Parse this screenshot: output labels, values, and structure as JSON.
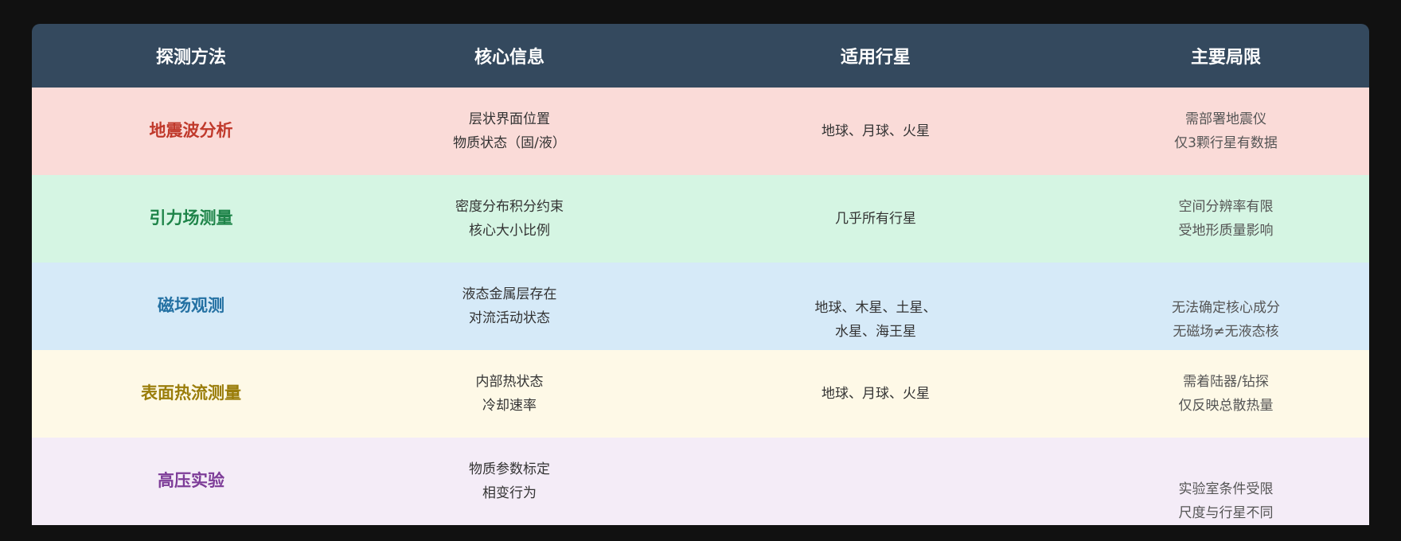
{
  "header": {
    "col_method": "探测方法",
    "col_info": "核心信息",
    "col_planets": "适用行星",
    "col_limits": "主要局限"
  },
  "rows": [
    {
      "method": "地震波分析",
      "method_color": "#c0392b",
      "bg": "#fadbd8",
      "info": [
        "层状界面位置",
        "物质状态（固/液）"
      ],
      "planets": [
        "地球、月球、火星"
      ],
      "limits": [
        "需部署地震仪",
        "仅3颗行星有数据"
      ]
    },
    {
      "method": "引力场测量",
      "method_color": "#1e8449",
      "bg": "#d5f5e3",
      "info": [
        "密度分布积分约束",
        "核心大小比例"
      ],
      "planets": [
        "几乎所有行星"
      ],
      "limits": [
        "空间分辨率有限",
        "受地形质量影响"
      ]
    },
    {
      "method": "磁场观测",
      "method_color": "#2471a3",
      "bg": "#d6eaf8",
      "info": [
        "液态金属层存在",
        "对流活动状态"
      ],
      "planets": [
        "地球、木星、土星、",
        "水星、海王星"
      ],
      "limits": [
        "无法确定核心成分",
        "无磁场≠无液态核"
      ]
    },
    {
      "method": "表面热流测量",
      "method_color": "#9a7d0a",
      "bg": "#fef9e7",
      "info": [
        "内部热状态",
        "冷却速率"
      ],
      "planets": [
        "地球、月球、火星"
      ],
      "limits": [
        "需着陆器/钻探",
        "仅反映总散热量"
      ]
    },
    {
      "method": "高压实验",
      "method_color": "#7d3c98",
      "bg": "#f4ecf7",
      "info": [
        "物质参数标定",
        "相变行为"
      ],
      "planets": [],
      "limits": [
        "实验室条件受限",
        "尺度与行星不同"
      ]
    }
  ]
}
